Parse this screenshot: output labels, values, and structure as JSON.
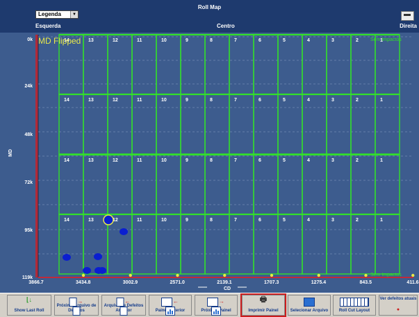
{
  "header": {
    "title": "Roll Map",
    "legend_select": "Legenda",
    "left_label": "Esquerda",
    "center_label": "Centro",
    "right_label": "Direita"
  },
  "plot": {
    "overlay_text": "MD Flipped",
    "top_right_label": "Sem Impactos",
    "bottom_right_label": "Sem Impactos",
    "y_axis_label": "MD",
    "x_axis_label": "CD",
    "y_ticks": [
      "0k",
      "24k",
      "48k",
      "72k",
      "95k",
      "119k"
    ],
    "x_ticks": [
      "3866.7",
      "3434.8",
      "3002.9",
      "2571.0",
      "2139.1",
      "1707.3",
      "1275.4",
      "843.5",
      "411.6"
    ],
    "lane_numbers": [
      "14",
      "13",
      "12",
      "11",
      "10",
      "9",
      "8",
      "7",
      "6",
      "5",
      "4",
      "3",
      "2",
      "1"
    ],
    "colors": {
      "background": "#3d5c8e",
      "grid_line": "#32e02a",
      "defect": "#0a1ed0",
      "highlight": "#e8e84a"
    }
  },
  "toolbar": {
    "show_last_roll": "Show Last Roll",
    "next_defect_file": "Próximo Arquivo de Defeitos",
    "prev_defect_file": "Arquivo de Defeitos Anterior",
    "prev_panel": "Painel Anterior",
    "next_panel": "Próximo Painel",
    "print_panel": "Imprimir Painel",
    "select_file": "Selecionar Arquivo",
    "roll_cut_layout": "Roll Cut Layout",
    "view_current_defects": "Ver defeitos atuais"
  }
}
